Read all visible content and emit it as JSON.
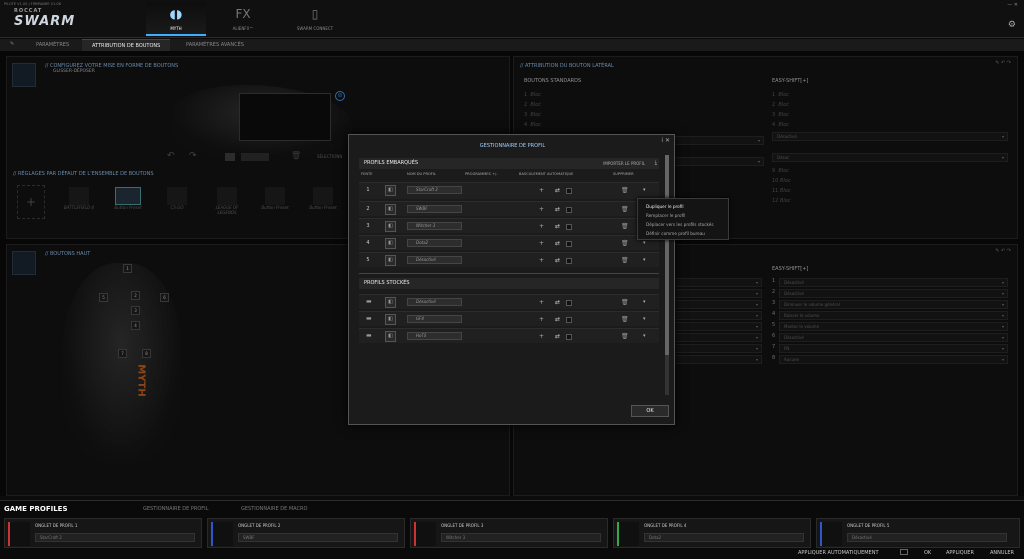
{
  "app": {
    "version": "PILOTE V1.00 | FIRMWARE V1.06",
    "brand_small": "ROCCAT",
    "brand": "SWARM"
  },
  "topnav": [
    {
      "label": "MYTH",
      "active": true
    },
    {
      "label": "ALIENFX™",
      "active": false
    },
    {
      "label": "SWARM CONNECT",
      "active": false
    }
  ],
  "tabs": [
    "PARAMÈTRES",
    "ATTRIBUTION DE BOUTONS",
    "PARAMÈTRES AVANCÉS"
  ],
  "left_top": {
    "title": "// CONFIGUREZ VOTRE MISE EN FORME DE BOUTONS",
    "subtitle": "GLISSER-DÉPOSER",
    "select_label": "SÉLECTIONN"
  },
  "presets": {
    "title": "// RÉGLAGES PAR DÉFAUT DE L'ENSEMBLE DE BOUTONS",
    "items": [
      "BATTLEFIELD 4",
      "Button Preset",
      "CS:GO",
      "LEAGUE OF LEGENDS",
      "Button Preset",
      "Button Preset"
    ]
  },
  "left_bottom": {
    "title": "// BOUTONS HAUT",
    "keys": [
      "1",
      "2",
      "3",
      "4",
      "5",
      "6",
      "7",
      "8"
    ]
  },
  "right_top": {
    "title": "// ATTRIBUTION DU BOUTON LATÉRAL",
    "col1": "BOUTONS STANDARDS",
    "col2": "EASY-SHIFT[+]",
    "left_rows": [
      "Bloc",
      "Bloc",
      "Bloc",
      "Bloc"
    ],
    "right_rows": [
      "Bloc",
      "Bloc",
      "Bloc",
      "Bloc",
      "Désactivé",
      "Désac",
      "Bloc",
      "Bloc",
      "Bloc",
      "Bloc"
    ]
  },
  "right_bottom": {
    "col2": "EASY-SHIFT[+]",
    "rows": [
      "Désactivé",
      "Désactivé",
      "Diminuer le volume général",
      "Baisser le volume",
      "Monter le volume",
      "Désactivé",
      "FN",
      "Aucune"
    ]
  },
  "modal": {
    "title": "GESTIONNAIRE DE PROFIL",
    "section1": "PROFILS EMBARQUÉS",
    "import_label": "IMPORTER LE PROFIL",
    "columns": [
      "FENTE",
      "NOM DU PROFIL",
      "PROGRAMMES +/-",
      "BASCULEMENT AUTOMATIQUE",
      "SUPPRIMER"
    ],
    "onboard": [
      {
        "n": "1",
        "name": "StarCraft 2"
      },
      {
        "n": "2",
        "name": "SWBF"
      },
      {
        "n": "3",
        "name": "Witcher 3"
      },
      {
        "n": "4",
        "name": "Dota2"
      },
      {
        "n": "5",
        "name": "Désactivé"
      }
    ],
    "section2": "PROFILS STOCKÉS",
    "stored": [
      {
        "name": "Désactivé"
      },
      {
        "name": "GF4"
      },
      {
        "name": "HoTS"
      }
    ],
    "ok": "OK",
    "context_menu": [
      "Dupliquer le profil",
      "Remplacer le profil",
      "Déplacer vers les profils stockés",
      "Définir comme profil bureau"
    ]
  },
  "bottom": {
    "tabs": [
      "GAME PROFILES",
      "GESTIONNAIRE DE PROFIL",
      "GESTIONNAIRE DE MACRO"
    ],
    "slots": [
      {
        "label": "ONGLET DE PROFIL 1",
        "value": "StarCraft 2",
        "color": "#cc3333"
      },
      {
        "label": "ONGLET DE PROFIL 2",
        "value": "SWBF",
        "color": "#3355cc"
      },
      {
        "label": "ONGLET DE PROFIL 3",
        "value": "Witcher 3",
        "color": "#cc3333"
      },
      {
        "label": "ONGLET DE PROFIL 4",
        "value": "Dota2",
        "color": "#33aa44"
      },
      {
        "label": "ONGLET DE PROFIL 5",
        "value": "Désactivé",
        "color": "#3355cc"
      }
    ],
    "auto_apply": "APPLIQUER AUTOMATIQUEMENT",
    "buttons": [
      "OK",
      "APPLIQUER",
      "ANNULER"
    ]
  }
}
